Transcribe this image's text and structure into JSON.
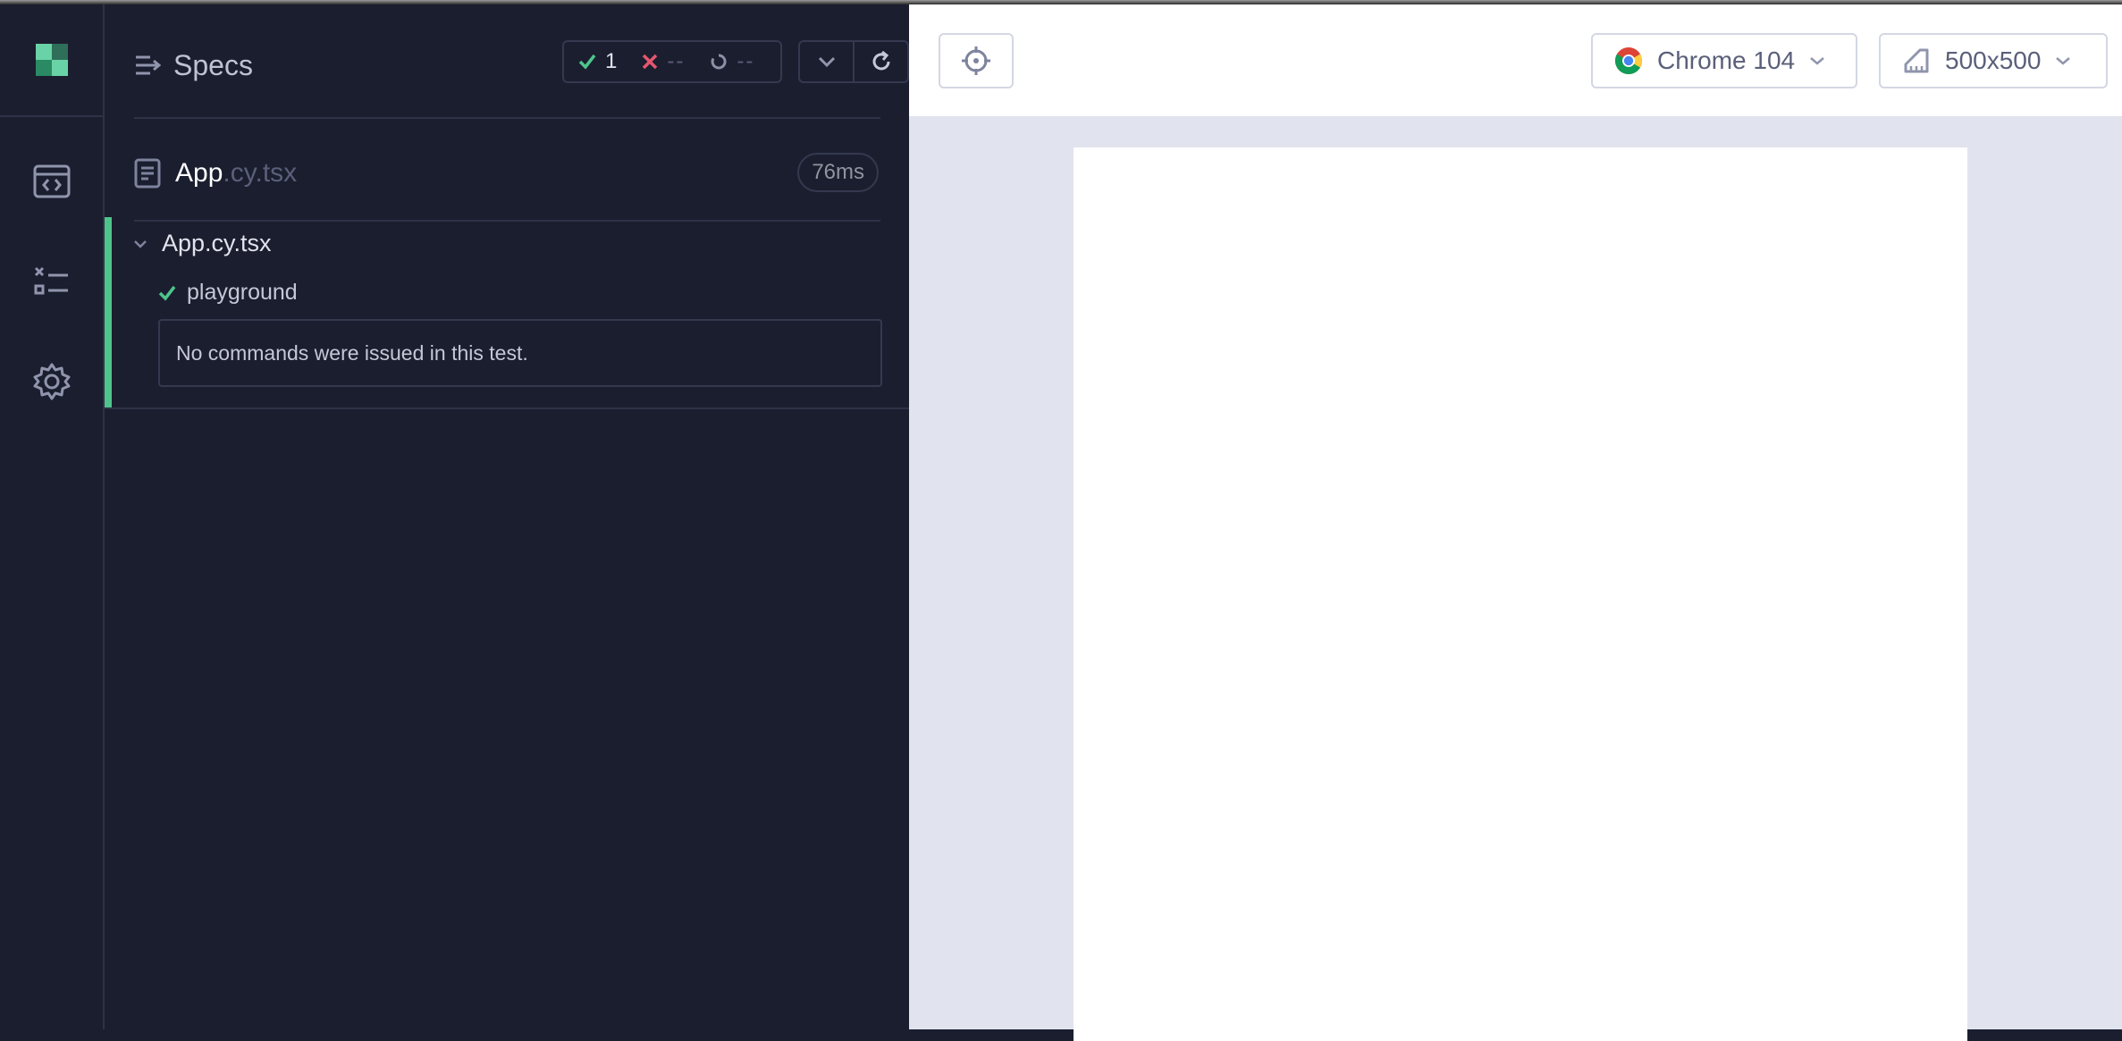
{
  "nav": {
    "items": [
      {
        "name": "specs",
        "icon": "code-window-icon"
      },
      {
        "name": "runs",
        "icon": "list-check-icon"
      },
      {
        "name": "settings",
        "icon": "gear-icon"
      }
    ]
  },
  "reporter": {
    "specs_label": "Specs",
    "stats": {
      "passed": "1",
      "failed": "--",
      "pending": "--"
    },
    "file": {
      "name": "App",
      "ext": ".cy.tsx",
      "duration": "76ms"
    },
    "suite": {
      "title": "App.cy.tsx",
      "tests": [
        {
          "title": "playground",
          "state": "passed",
          "message": "No commands were issued in this test."
        }
      ]
    }
  },
  "preview": {
    "browser": "Chrome 104",
    "viewport": "500x500"
  },
  "colors": {
    "pass": "#4ec48c",
    "fail": "#e45770",
    "panel_bg": "#1b1e2e",
    "preview_bg": "#e1e4ee"
  }
}
